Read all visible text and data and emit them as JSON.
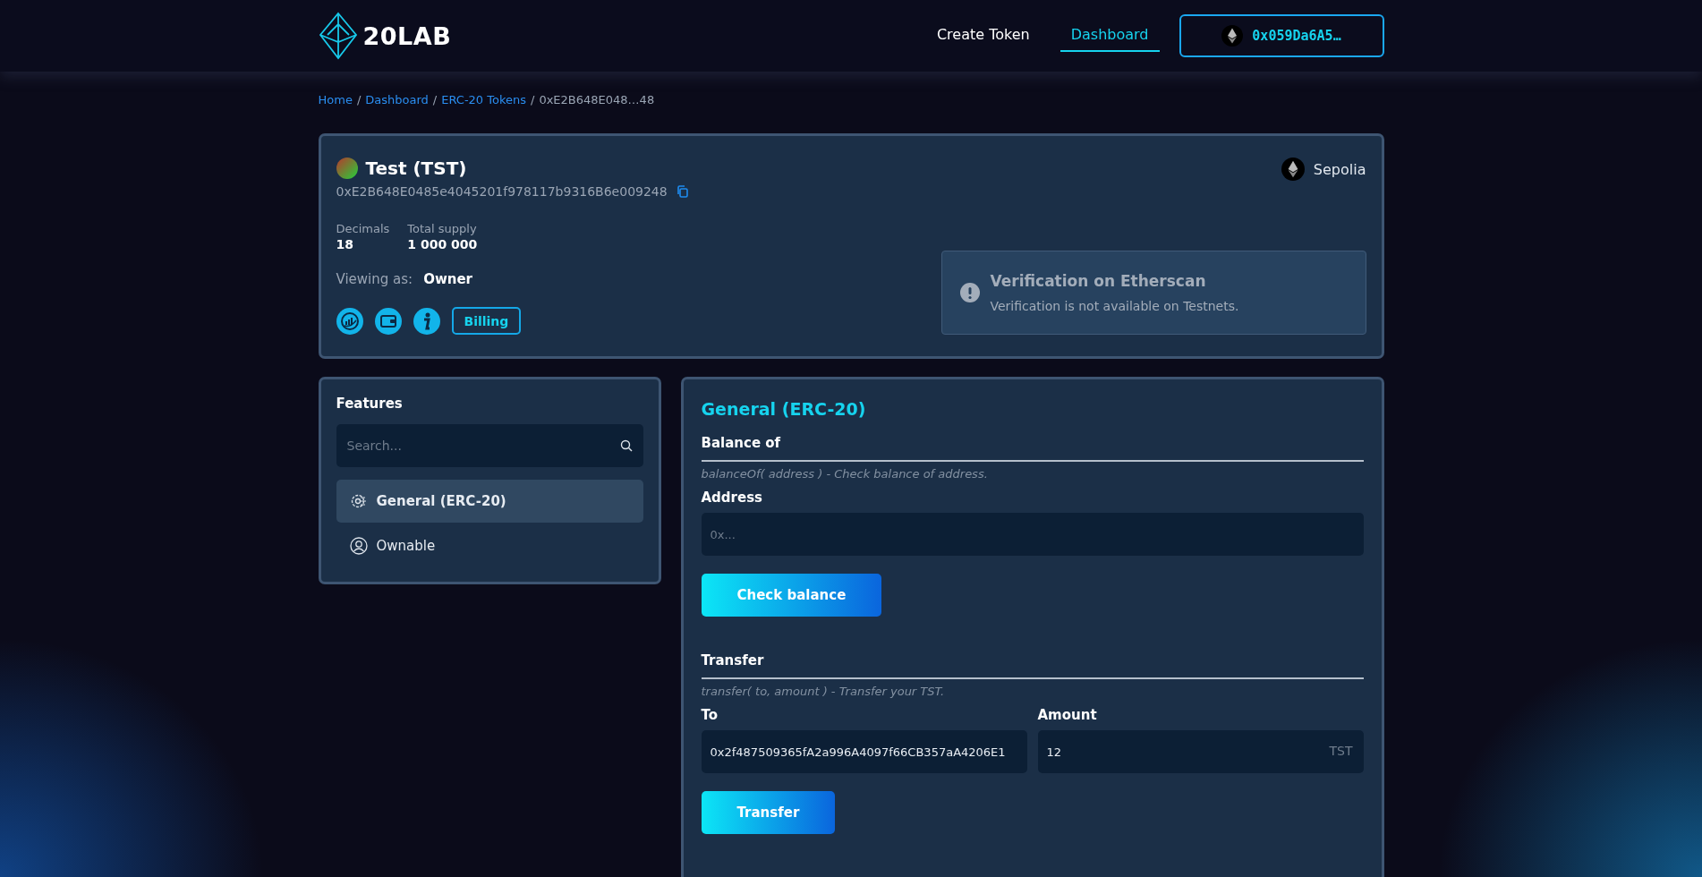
{
  "header": {
    "logo": "20LAB",
    "nav": [
      {
        "label": "Create Token",
        "selected": false
      },
      {
        "label": "Dashboard",
        "selected": true
      }
    ],
    "wallet": {
      "address": "0x059Da6A5…"
    }
  },
  "breadcrumb_separator": "/",
  "breadcrumb": [
    {
      "label": "Home",
      "kind": "link"
    },
    {
      "label": "Dashboard",
      "kind": "link"
    },
    {
      "label": "ERC-20 Tokens",
      "kind": "link"
    },
    {
      "label": "0xE2B648E048…48",
      "kind": "current"
    }
  ],
  "token": {
    "name": "Test (TST)",
    "address": "0xE2B648E0485e4045201f978117b9316B6e009248",
    "network": "Sepolia",
    "stats": [
      {
        "label": "Decimals",
        "value": "18"
      },
      {
        "label": "Total supply",
        "value": "1 000 000"
      }
    ],
    "viewing_label": "Viewing as:",
    "viewing_value": "Owner",
    "actions": [
      {
        "kind": "chart"
      },
      {
        "kind": "wallet"
      },
      {
        "kind": "info"
      },
      {
        "kind": "text",
        "label": "Billing"
      }
    ],
    "verification": {
      "title": "Verification on Etherscan",
      "message": "Verification is not available on Testnets."
    }
  },
  "features": {
    "title": "Features",
    "search_placeholder": "Search...",
    "items": [
      {
        "label": "General (ERC-20)",
        "kind": "chip",
        "selected": true
      },
      {
        "label": "Ownable",
        "kind": "user",
        "selected": false
      }
    ]
  },
  "panel": {
    "title": "General (ERC-20)",
    "sections": [
      {
        "title": "Balance of",
        "description": "balanceOf( address ) - Check balance of address.",
        "fields": [
          {
            "label": "Address",
            "placeholder": "0x..."
          }
        ],
        "button": "Check balance"
      },
      {
        "title": "Transfer",
        "description": "transfer( to, amount ) - Transfer your TST.",
        "fields": [
          {
            "label": "To",
            "value": "0x2f487509365fA2a996A4097f66CB357aA4206E1"
          },
          {
            "label": "Amount",
            "value": "12",
            "suffix": "TST"
          }
        ],
        "button": "Transfer"
      }
    ]
  }
}
